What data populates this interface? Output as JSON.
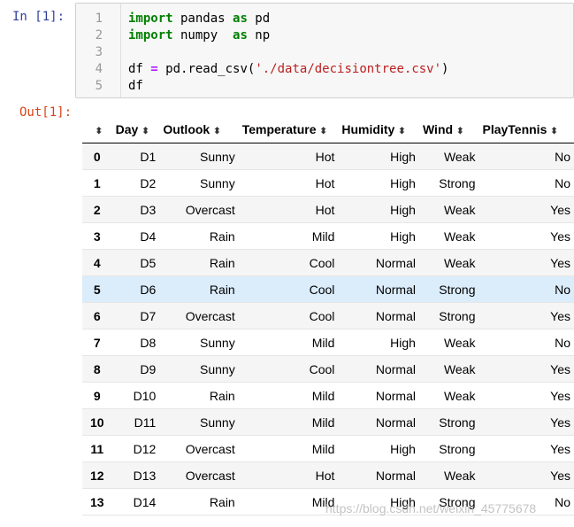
{
  "input_prompt": "In  [1]:",
  "output_prompt": "Out[1]:",
  "code": [
    {
      "n": "1",
      "parts": [
        {
          "t": "import",
          "c": "kw"
        },
        {
          "t": " pandas ",
          "c": ""
        },
        {
          "t": "as",
          "c": "kw"
        },
        {
          "t": " pd",
          "c": ""
        }
      ]
    },
    {
      "n": "2",
      "parts": [
        {
          "t": "import",
          "c": "kw"
        },
        {
          "t": " numpy  ",
          "c": ""
        },
        {
          "t": "as",
          "c": "kw"
        },
        {
          "t": " np",
          "c": ""
        }
      ]
    },
    {
      "n": "3",
      "parts": []
    },
    {
      "n": "4",
      "parts": [
        {
          "t": "df ",
          "c": ""
        },
        {
          "t": "=",
          "c": "op"
        },
        {
          "t": " pd.read_csv(",
          "c": ""
        },
        {
          "t": "'./data/decisiontree.csv'",
          "c": "str"
        },
        {
          "t": ")",
          "c": ""
        }
      ]
    },
    {
      "n": "5",
      "parts": [
        {
          "t": "df",
          "c": ""
        }
      ]
    }
  ],
  "table": {
    "sort_icon": "⬍",
    "columns": [
      "",
      "Day",
      "Outlook",
      "Temperature",
      "Humidity",
      "Wind",
      "PlayTennis"
    ],
    "highlighted_row": 5,
    "rows": [
      [
        "0",
        "D1",
        "Sunny",
        "Hot",
        "High",
        "Weak",
        "No"
      ],
      [
        "1",
        "D2",
        "Sunny",
        "Hot",
        "High",
        "Strong",
        "No"
      ],
      [
        "2",
        "D3",
        "Overcast",
        "Hot",
        "High",
        "Weak",
        "Yes"
      ],
      [
        "3",
        "D4",
        "Rain",
        "Mild",
        "High",
        "Weak",
        "Yes"
      ],
      [
        "4",
        "D5",
        "Rain",
        "Cool",
        "Normal",
        "Weak",
        "Yes"
      ],
      [
        "5",
        "D6",
        "Rain",
        "Cool",
        "Normal",
        "Strong",
        "No"
      ],
      [
        "6",
        "D7",
        "Overcast",
        "Cool",
        "Normal",
        "Strong",
        "Yes"
      ],
      [
        "7",
        "D8",
        "Sunny",
        "Mild",
        "High",
        "Weak",
        "No"
      ],
      [
        "8",
        "D9",
        "Sunny",
        "Cool",
        "Normal",
        "Weak",
        "Yes"
      ],
      [
        "9",
        "D10",
        "Rain",
        "Mild",
        "Normal",
        "Weak",
        "Yes"
      ],
      [
        "10",
        "D11",
        "Sunny",
        "Mild",
        "Normal",
        "Strong",
        "Yes"
      ],
      [
        "11",
        "D12",
        "Overcast",
        "Mild",
        "High",
        "Strong",
        "Yes"
      ],
      [
        "12",
        "D13",
        "Overcast",
        "Hot",
        "Normal",
        "Weak",
        "Yes"
      ],
      [
        "13",
        "D14",
        "Rain",
        "Mild",
        "High",
        "Strong",
        "No"
      ]
    ]
  },
  "watermark": "https://blog.csdn.net/weixin_45775678"
}
